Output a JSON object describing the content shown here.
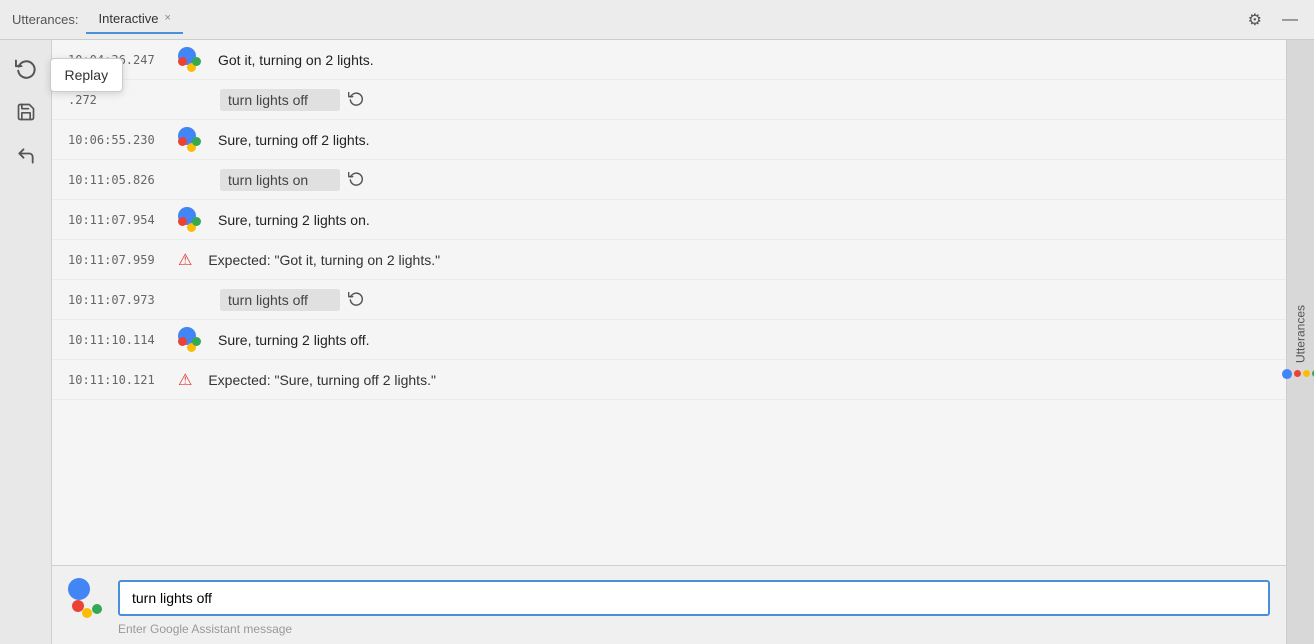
{
  "titleBar": {
    "label": "Utterances:",
    "tab": {
      "name": "Interactive",
      "closeBtn": "×"
    },
    "gearIcon": "⚙",
    "minimizeIcon": "—"
  },
  "sidebar": {
    "replayIcon": "↺",
    "replayTooltip": "Replay",
    "saveIcon": "💾",
    "undoIcon": "↩"
  },
  "conversation": [
    {
      "id": "row1",
      "timestamp": "10:04:36.247",
      "type": "assistant",
      "text": "Got it, turning on 2 lights."
    },
    {
      "id": "row2",
      "timestamp": ".272",
      "type": "utterance",
      "text": "turn lights off",
      "hasReplay": true
    },
    {
      "id": "row3",
      "timestamp": "10:06:55.230",
      "type": "assistant",
      "text": "Sure, turning off 2 lights."
    },
    {
      "id": "row4",
      "timestamp": "10:11:05.826",
      "type": "utterance",
      "text": "turn lights on",
      "hasReplay": true
    },
    {
      "id": "row5",
      "timestamp": "10:11:07.954",
      "type": "assistant",
      "text": "Sure, turning 2 lights on."
    },
    {
      "id": "row6",
      "timestamp": "10:11:07.959",
      "type": "expected",
      "text": "Expected: \"Got it, turning on 2 lights.\""
    },
    {
      "id": "row7",
      "timestamp": "10:11:07.973",
      "type": "utterance",
      "text": "turn lights off",
      "hasReplay": true
    },
    {
      "id": "row8",
      "timestamp": "10:11:10.114",
      "type": "assistant",
      "text": "Sure, turning 2 lights off."
    },
    {
      "id": "row9",
      "timestamp": "10:11:10.121",
      "type": "expected",
      "text": "Expected: \"Sure, turning off 2 lights.\""
    }
  ],
  "inputArea": {
    "currentValue": "turn lights off",
    "placeholder": "Enter Google Assistant message"
  },
  "rightSidebar": {
    "label": "Utterances"
  }
}
